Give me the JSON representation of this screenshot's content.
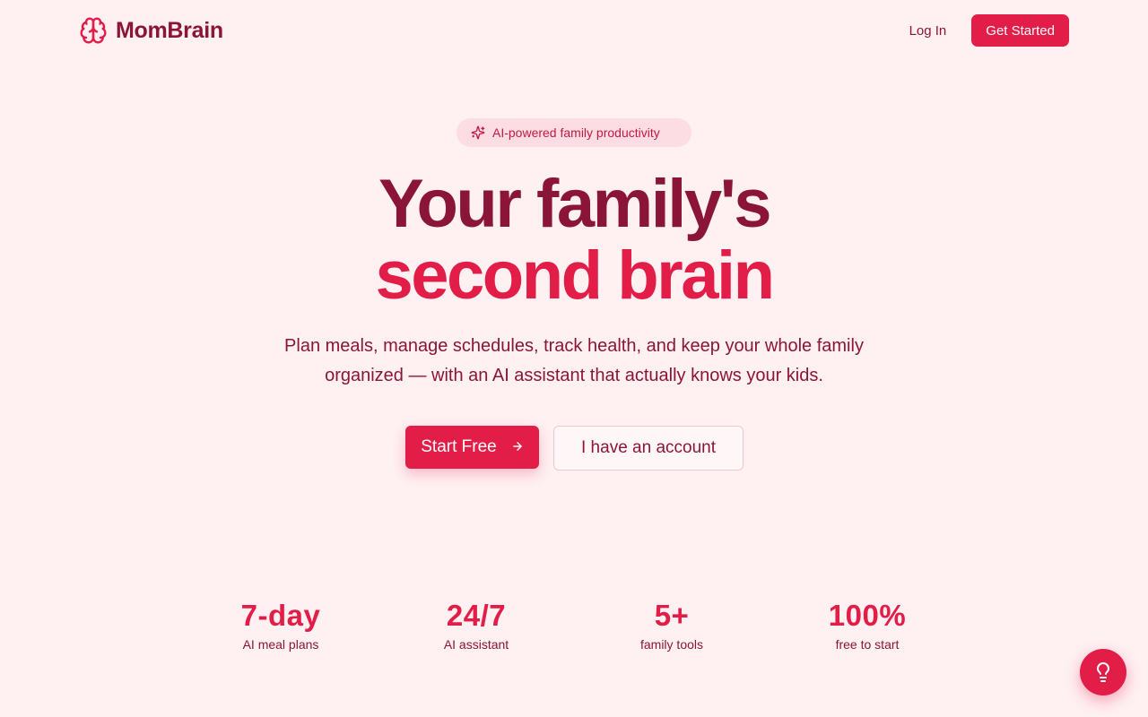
{
  "brand": {
    "name": "MomBrain",
    "icon": "brain-icon"
  },
  "nav": {
    "login": "Log In",
    "get_started": "Get Started"
  },
  "badge": {
    "icon": "sparkles-icon",
    "text": "AI-powered family productivity"
  },
  "hero": {
    "headline_line1": "Your family's",
    "headline_line2": "second brain",
    "subtitle": "Plan meals, manage schedules, track health, and keep your whole family organized — with an AI assistant that actually knows your kids.",
    "primary_cta": "Start Free",
    "primary_cta_icon": "arrow-right-icon",
    "secondary_cta": "I have an account"
  },
  "stats": [
    {
      "value": "7-day",
      "label": "AI meal plans"
    },
    {
      "value": "24/7",
      "label": "AI assistant"
    },
    {
      "value": "5+",
      "label": "family tools"
    },
    {
      "value": "100%",
      "label": "free to start"
    }
  ],
  "fab": {
    "icon": "lightbulb-icon"
  },
  "colors": {
    "background": "#fff0f2",
    "accent": "#e11d48",
    "text": "#8b1538",
    "badge_bg": "#fcdde3"
  }
}
